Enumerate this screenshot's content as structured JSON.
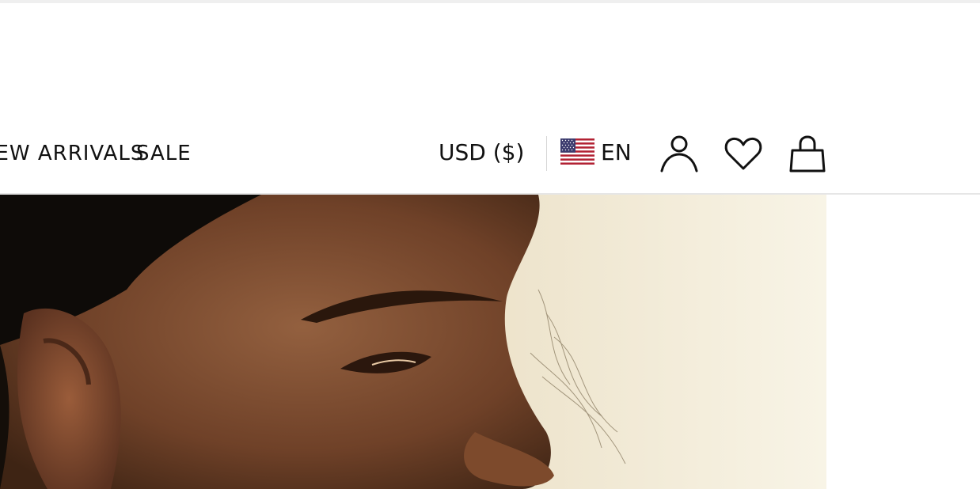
{
  "nav": {
    "items": [
      {
        "label": "NEW ARRIVALS"
      },
      {
        "label": "SALE"
      }
    ]
  },
  "locale": {
    "currency_label": "USD ($)",
    "language_label": "EN",
    "flag_icon": "us-flag-icon"
  },
  "actions": {
    "account_icon": "account-icon",
    "wishlist_icon": "heart-icon",
    "bag_icon": "shopping-bag-icon"
  },
  "hero": {
    "image": "woman-face-closeup"
  },
  "colors": {
    "text": "#111111",
    "divider": "#e6e6e6",
    "hero_bg_light": "#f3ecd8",
    "skin": "#7a4a2f",
    "hair": "#0d0b08"
  }
}
